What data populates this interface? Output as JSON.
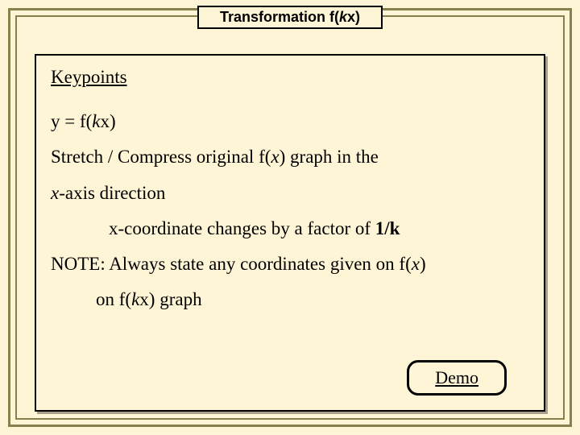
{
  "title": {
    "prefix": "Transformation f(",
    "var": "k",
    "suffix": "x)"
  },
  "content": {
    "keypoints_label": "Keypoints",
    "eq_prefix": "y = f(",
    "eq_var": "k",
    "eq_suffix": "x)",
    "desc1_a": "Stretch / Compress original f(",
    "desc1_b": "x",
    "desc1_c": ") graph in the",
    "desc2_a": "x",
    "desc2_b": "-axis direction",
    "coord_a": "x-coordinate changes by a factor of ",
    "coord_b": "1/k",
    "note1_a": "NOTE: Always state any coordinates given on f(",
    "note1_b": "x",
    "note1_c": ")",
    "note2_a": "on f(",
    "note2_b": "k",
    "note2_c": "x) graph"
  },
  "demo_label": "Demo"
}
